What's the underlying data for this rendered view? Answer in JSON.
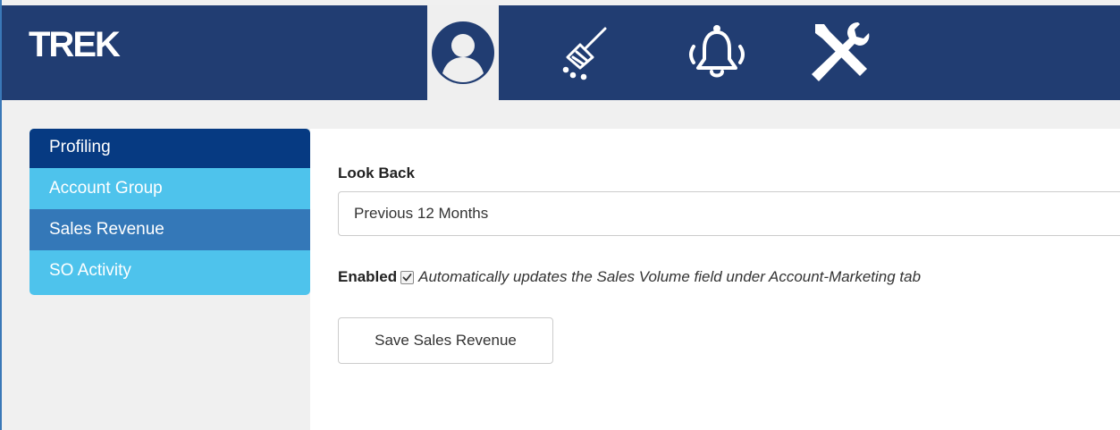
{
  "app": {
    "logo": "TREK"
  },
  "header": {
    "tabs": [
      {
        "icon": "user-icon",
        "active": true
      },
      {
        "icon": "broom-icon",
        "active": false
      },
      {
        "icon": "bell-icon",
        "active": false
      },
      {
        "icon": "tools-icon",
        "active": false
      }
    ]
  },
  "sidebar": {
    "items": [
      {
        "label": "Profiling"
      },
      {
        "label": "Account Group"
      },
      {
        "label": "Sales Revenue",
        "selected": true
      },
      {
        "label": "SO Activity"
      }
    ]
  },
  "form": {
    "lookback_label": "Look Back",
    "lookback_value": "Previous 12 Months",
    "enabled_label": "Enabled",
    "enabled_checked": true,
    "enabled_note": "Automatically updates the Sales Volume field under Account-Marketing tab",
    "save_label": "Save Sales Revenue"
  },
  "colors": {
    "header_bg": "#213d72",
    "sidebar_bg": "#4ec3ec",
    "sidebar_first": "#063a82",
    "sidebar_selected": "#3478b8"
  }
}
